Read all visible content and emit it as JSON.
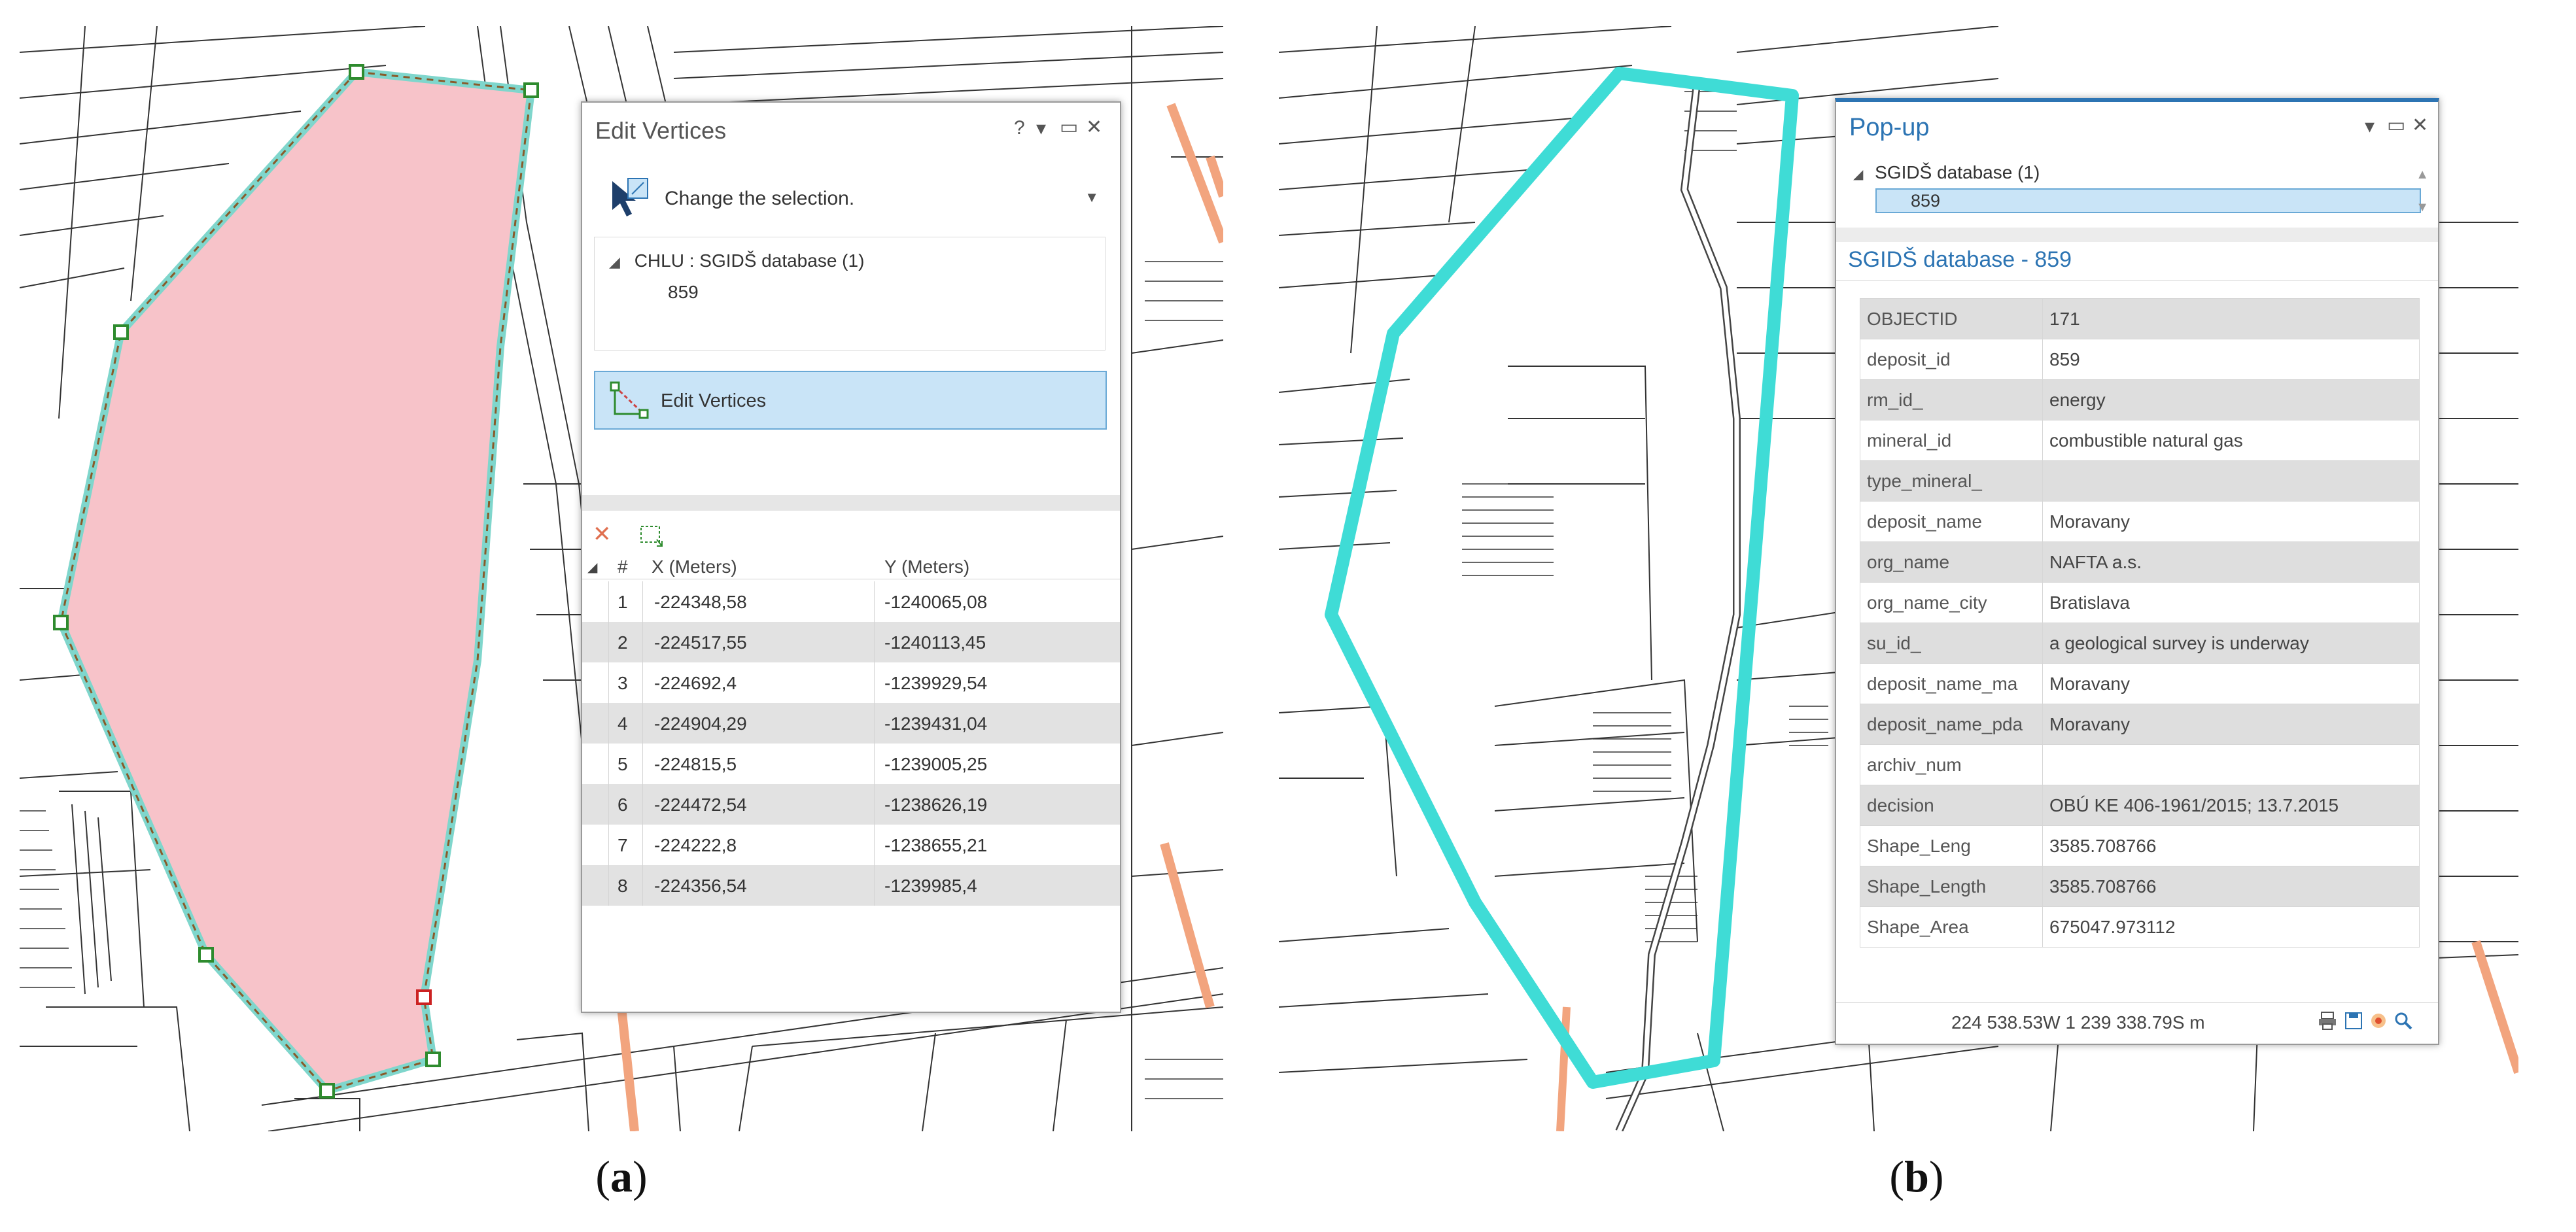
{
  "panels": {
    "edit_vertices": {
      "title": "Edit Vertices",
      "help": "?",
      "dropdown_glyph": "▾",
      "pin": "▭",
      "close": "✕",
      "change_selection": "Change the selection.",
      "selection_dropdown": "▼",
      "tree_expander": "◢",
      "tree_layer": "CHLU : SGIDŠ database (1)",
      "tree_feature": "859",
      "edit_button": "Edit Vertices",
      "delete_icon": "✕",
      "table_headers": {
        "expander": "◢",
        "num": "#",
        "x": "X (Meters)",
        "y": "Y (Meters)"
      },
      "vertices": [
        {
          "n": "1",
          "x": "-224348,58",
          "y": "-1240065,08"
        },
        {
          "n": "2",
          "x": "-224517,55",
          "y": "-1240113,45"
        },
        {
          "n": "3",
          "x": "-224692,4",
          "y": "-1239929,54"
        },
        {
          "n": "4",
          "x": "-224904,29",
          "y": "-1239431,04"
        },
        {
          "n": "5",
          "x": "-224815,5",
          "y": "-1239005,25"
        },
        {
          "n": "6",
          "x": "-224472,54",
          "y": "-1238626,19"
        },
        {
          "n": "7",
          "x": "-224222,8",
          "y": "-1238655,21"
        },
        {
          "n": "8",
          "x": "-224356,54",
          "y": "-1239985,4"
        }
      ]
    },
    "popup": {
      "title": "Pop-up",
      "dropdown_glyph": "▾",
      "pin": "▭",
      "close": "✕",
      "tree_expander": "◢",
      "tree_layer": "SGIDŠ database  (1)",
      "tree_feature": "859",
      "scroll_up": "▲",
      "scroll_down": "▼",
      "subtitle": "SGIDŠ database - 859",
      "attributes": [
        {
          "k": "OBJECTID",
          "v": "171"
        },
        {
          "k": "deposit_id",
          "v": "859"
        },
        {
          "k": "rm_id_",
          "v": "energy"
        },
        {
          "k": "mineral_id",
          "v": "combustible natural gas"
        },
        {
          "k": "type_mineral_",
          "v": ""
        },
        {
          "k": "deposit_name",
          "v": "Moravany"
        },
        {
          "k": "org_name",
          "v": "NAFTA a.s."
        },
        {
          "k": "org_name_city",
          "v": "Bratislava"
        },
        {
          "k": "su_id_",
          "v": "a geological survey is underway"
        },
        {
          "k": "deposit_name_ma",
          "v": "Moravany"
        },
        {
          "k": "deposit_name_pda",
          "v": "Moravany"
        },
        {
          "k": "archiv_num",
          "v": ""
        },
        {
          "k": "decision",
          "v": "OBÚ KE 406-1961/2015; 13.7.2015"
        },
        {
          "k": "Shape_Leng",
          "v": "3585.708766"
        },
        {
          "k": "Shape_Length",
          "v": "3585.708766"
        },
        {
          "k": "Shape_Area",
          "v": "675047.973112"
        }
      ],
      "footer_coords": "224 538.53W 1 239 338.79S m",
      "footer_icons": [
        "print-icon",
        "save-icon",
        "flash-icon",
        "zoom-icon"
      ]
    }
  },
  "labels": {
    "a": "a",
    "b": "b"
  },
  "colors": {
    "polygon_fill": "#f7c3c9",
    "polygon_outline": "#7fd6cc",
    "deposit_outline": "#3fdcd6",
    "road": "#f2a47e",
    "selection_blue": "#c9e4f7",
    "accent_blue": "#2c74b3"
  }
}
